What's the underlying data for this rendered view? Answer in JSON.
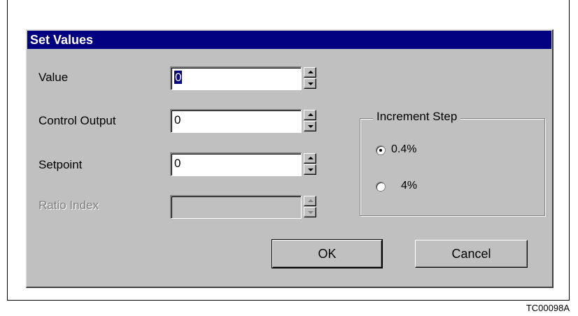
{
  "dialog": {
    "title": "Set Values",
    "fields": [
      {
        "label": "Value",
        "value": "0",
        "enabled": true
      },
      {
        "label": "Control Output",
        "value": "0",
        "enabled": true
      },
      {
        "label": "Setpoint",
        "value": "0",
        "enabled": true
      },
      {
        "label": "Ratio Index",
        "value": "",
        "enabled": false
      }
    ],
    "increment_group": {
      "title": "Increment Step",
      "options": [
        {
          "label": "0.4%",
          "selected": true
        },
        {
          "label": "4%",
          "selected": false
        }
      ]
    },
    "buttons": {
      "ok": "OK",
      "cancel": "Cancel"
    }
  },
  "figure_code": "TC00098A",
  "colors": {
    "titlebar": "#000080",
    "dialog_bg": "#c0c0c0"
  }
}
